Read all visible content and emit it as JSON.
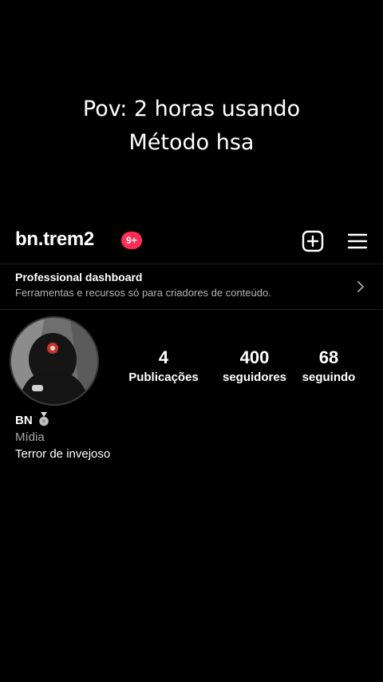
{
  "overlay": {
    "line1": "Pov: 2 horas usando",
    "line2": "Método hsa"
  },
  "header": {
    "username": "bn.trem2",
    "notification_badge": "9+",
    "new_post_icon": "plus-square-icon",
    "menu_icon": "hamburger-menu-icon"
  },
  "professional_dashboard": {
    "title": "Professional dashboard",
    "subtitle": "Ferramentas e recursos só para criadores de conteúdo.",
    "chevron_icon": "chevron-right-icon"
  },
  "profile": {
    "avatar_icon": "profile-avatar",
    "stats": {
      "posts": {
        "value": "4",
        "label": "Publicações"
      },
      "followers": {
        "value": "400",
        "label": "seguidores"
      },
      "following": {
        "value": "68",
        "label": "seguindo"
      }
    },
    "name": "BN",
    "name_badge_icon": "medal-icon",
    "category": "Mídia",
    "bio": "Terror de invejoso"
  },
  "colors": {
    "background": "#000000",
    "text": "#ffffff",
    "secondary_text": "#a8a8a8",
    "badge": "#ff2d55"
  }
}
